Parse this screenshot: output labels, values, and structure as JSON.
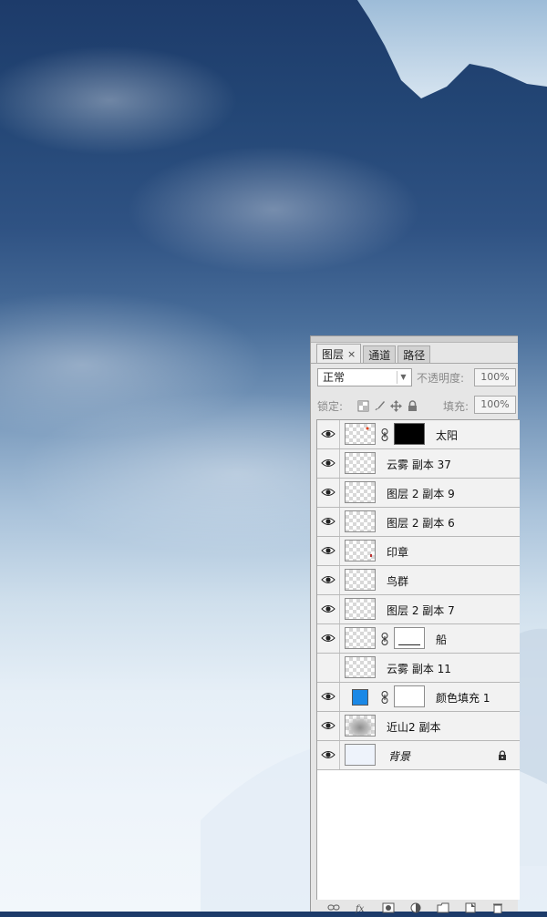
{
  "layers_panel": {
    "tabs": [
      {
        "label": "图层",
        "close": "×",
        "active": true
      },
      {
        "label": "通道",
        "active": false
      },
      {
        "label": "路径",
        "active": false
      }
    ],
    "blend_mode": "正常",
    "opacity_label": "不透明度:",
    "opacity_value": "100%",
    "lock_label": "锁定:",
    "lock_icons": [
      "lock-transparent-icon",
      "lock-brush-icon",
      "lock-move-icon",
      "lock-all-icon"
    ],
    "fill_label": "填充:",
    "fill_value": "100%",
    "layers": [
      {
        "name": "太阳",
        "visible": true,
        "mask": "black"
      },
      {
        "name": "云雾 副本 37",
        "visible": true
      },
      {
        "name": "图层 2 副本 9",
        "visible": true
      },
      {
        "name": "图层 2 副本 6",
        "visible": true
      },
      {
        "name": "印章",
        "visible": true
      },
      {
        "name": "鸟群",
        "visible": true
      },
      {
        "name": "图层 2 副本 7",
        "visible": true
      },
      {
        "name": "船",
        "visible": true,
        "mask": "white"
      },
      {
        "name": "云雾 副本 11",
        "visible": false
      },
      {
        "name": "颜色填充 1",
        "visible": true,
        "fill_color": "#1a88e6",
        "mask": "white"
      },
      {
        "name": "近山2 副本",
        "visible": true
      },
      {
        "name": "背景",
        "visible": true,
        "locked": true
      }
    ],
    "footer_icons": [
      "link-layers-icon",
      "fx-icon",
      "add-mask-icon",
      "adjustment-icon",
      "new-group-icon",
      "new-layer-icon",
      "trash-icon"
    ]
  }
}
